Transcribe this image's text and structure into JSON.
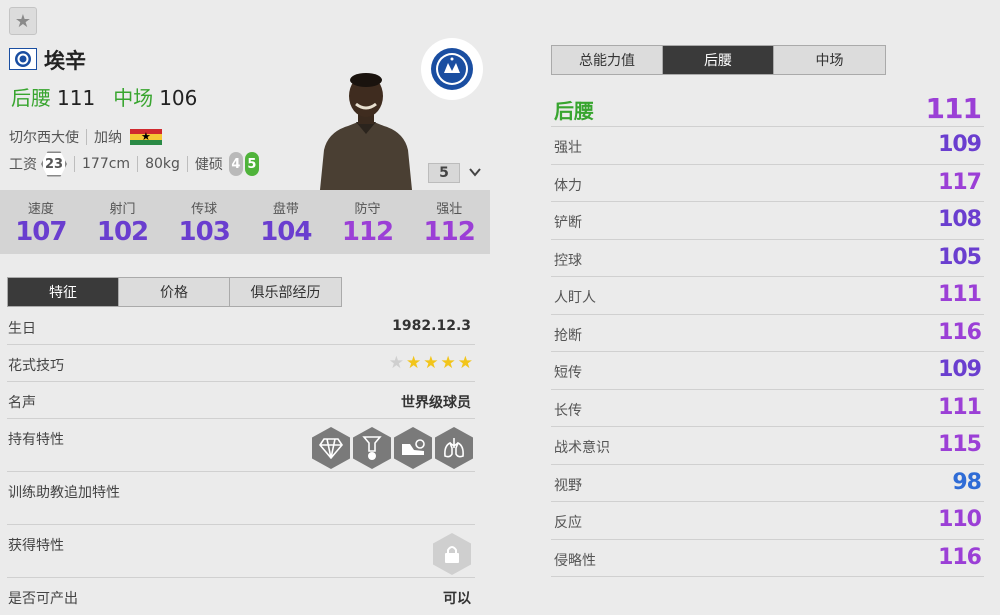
{
  "player": {
    "name": "埃辛",
    "positions": [
      {
        "pos": "后腰",
        "rating": "111"
      },
      {
        "pos": "中场",
        "rating": "106"
      }
    ],
    "club": "切尔西大使",
    "nationality": "加纳",
    "wage_label": "工资",
    "wage": "23",
    "height": "177cm",
    "weight": "80kg",
    "body_type": "健硕",
    "weak_foot_left": "4",
    "weak_foot_right": "5",
    "level": "5"
  },
  "stats": [
    {
      "label": "速度",
      "value": "107"
    },
    {
      "label": "射门",
      "value": "102"
    },
    {
      "label": "传球",
      "value": "103"
    },
    {
      "label": "盘带",
      "value": "104"
    },
    {
      "label": "防守",
      "value": "112"
    },
    {
      "label": "强壮",
      "value": "112"
    }
  ],
  "left_tabs": [
    "特征",
    "价格",
    "俱乐部经历"
  ],
  "info": {
    "birthday_label": "生日",
    "birthday": "1982.12.3",
    "skill_moves_label": "花式技巧",
    "skill_moves": 4,
    "skill_moves_max": 5,
    "reputation_label": "名声",
    "reputation": "世界级球员",
    "traits_label": "持有特性",
    "trait_icons": [
      "diamond-trait-icon",
      "power-header-trait-icon",
      "boot-dribble-trait-icon",
      "lungs-trait-icon"
    ],
    "coach_traits_label": "训练助教追加特性",
    "acquired_traits_label": "获得特性",
    "producible_label": "是否可产出",
    "producible": "可以"
  },
  "right_tabs": [
    "总能力值",
    "后腰",
    "中场"
  ],
  "position_head": {
    "label": "后腰",
    "value": "111"
  },
  "attributes": [
    {
      "label": "强壮",
      "value": "109",
      "color": "#6a3ecf"
    },
    {
      "label": "体力",
      "value": "117",
      "color": "#9b3fd6"
    },
    {
      "label": "铲断",
      "value": "108",
      "color": "#6a3ecf"
    },
    {
      "label": "控球",
      "value": "105",
      "color": "#6a3ecf"
    },
    {
      "label": "人盯人",
      "value": "111",
      "color": "#9b3fd6"
    },
    {
      "label": "抢断",
      "value": "116",
      "color": "#9b3fd6"
    },
    {
      "label": "短传",
      "value": "109",
      "color": "#6a3ecf"
    },
    {
      "label": "长传",
      "value": "111",
      "color": "#9b3fd6"
    },
    {
      "label": "战术意识",
      "value": "115",
      "color": "#9b3fd6"
    },
    {
      "label": "视野",
      "value": "98",
      "color": "#2f6cd6"
    },
    {
      "label": "反应",
      "value": "110",
      "color": "#9b3fd6"
    },
    {
      "label": "侵略性",
      "value": "116",
      "color": "#9b3fd6"
    }
  ],
  "colors": {
    "position_green": "#38a52f",
    "stat_violet": "#6a3ecf",
    "stat_purple": "#9b3fd6",
    "stat_blue": "#2f6cd6",
    "star_gold": "#f2c51b"
  }
}
